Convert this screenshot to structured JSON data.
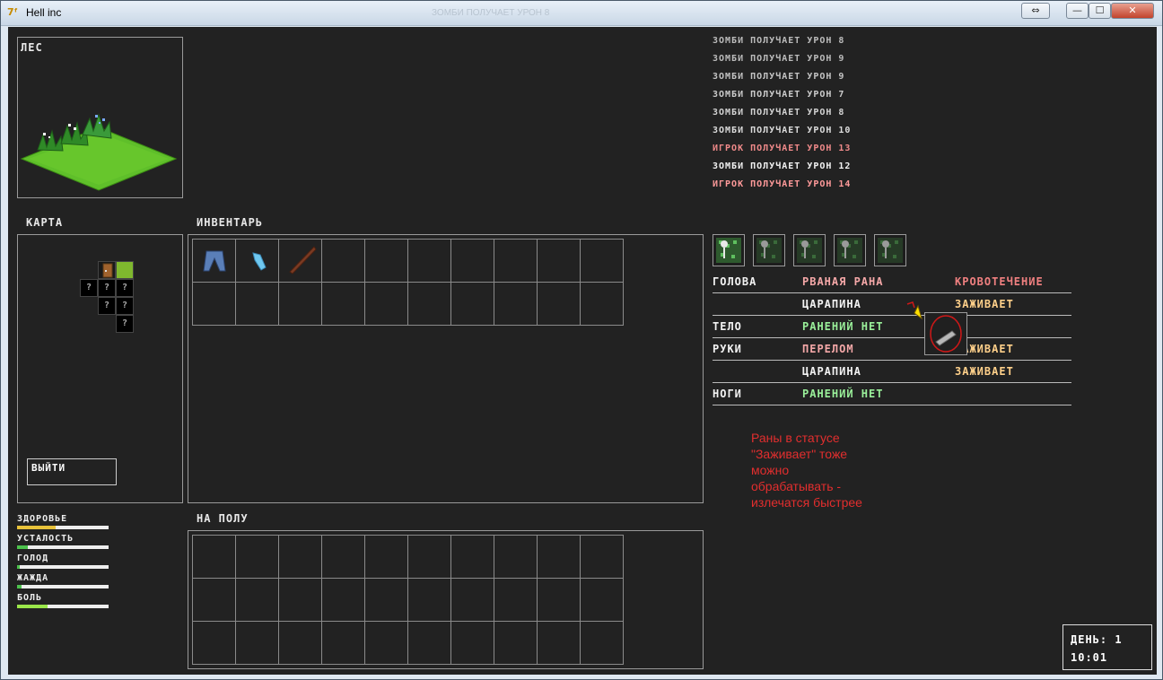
{
  "window": {
    "title": "Hell inc",
    "ghost_title": "ЗОМБИ ПОЛУЧАЕТ УРОН 8",
    "resize_label": "⇔",
    "min_label": "—",
    "max_label": "☐",
    "close_label": "✕"
  },
  "location": {
    "name": "ЛЕС"
  },
  "map": {
    "title": "КАРТА",
    "unknown_mark": "?",
    "exit_label": "ВЫЙТИ"
  },
  "inventory": {
    "title": "ИНВЕНТАРЬ",
    "items": [
      "pants-icon",
      "feather-icon",
      "stick-icon"
    ]
  },
  "floor": {
    "title": "НА ПОЛУ"
  },
  "stats": [
    {
      "name": "ЗДОРОВЬЕ",
      "value": 0.42,
      "color": "#e8c23a"
    },
    {
      "name": "УСТАЛОСТЬ",
      "value": 0.12,
      "color": "#4dc24d"
    },
    {
      "name": "ГОЛОД",
      "value": 0.03,
      "color": "#4dc24d"
    },
    {
      "name": "ЖАЖДА",
      "value": 0.05,
      "color": "#4dc24d"
    },
    {
      "name": "БОЛЬ",
      "value": 0.33,
      "color": "#9ae64a"
    }
  ],
  "log": [
    {
      "text": "ЗОМБИ ПОЛУЧАЕТ УРОН 8",
      "color": "#bcbcbc"
    },
    {
      "text": "ЗОМБИ ПОЛУЧАЕТ УРОН 9",
      "color": "#bcbcbc"
    },
    {
      "text": "ЗОМБИ ПОЛУЧАЕТ УРОН 9",
      "color": "#c4c4c4"
    },
    {
      "text": "ЗОМБИ ПОЛУЧАЕТ УРОН 7",
      "color": "#cccccc"
    },
    {
      "text": "ЗОМБИ ПОЛУЧАЕТ УРОН 8",
      "color": "#d4d4d4"
    },
    {
      "text": "ЗОМБИ ПОЛУЧАЕТ УРОН 10",
      "color": "#dcdcdc"
    },
    {
      "text": "ИГРОК ПОЛУЧАЕТ УРОН 13",
      "color": "#f08a8a"
    },
    {
      "text": "ЗОМБИ ПОЛУЧАЕТ УРОН 12",
      "color": "#f2f2f2"
    },
    {
      "text": "ИГРОК ПОЛУЧАЕТ УРОН 14",
      "color": "#ff9a9a"
    }
  ],
  "tabs": [
    "wounds-tab-icon",
    "heart-tab-icon",
    "grid-tab-icon",
    "plant-tab-icon",
    "sleep-tab-icon"
  ],
  "wounds": [
    {
      "part": "ГОЛОВА",
      "wound": "РВАНАЯ РАНА",
      "status": "КРОВОТЕЧЕНИЕ",
      "wound_color": "#f5a8a8",
      "status_color": "#f08080"
    },
    {
      "part": "",
      "wound": "ЦАРАПИНА",
      "status": "ЗАЖИВАЕТ",
      "wound_color": "#f2f2f2",
      "status_color": "#ffd08a"
    },
    {
      "part": "ТЕЛО",
      "wound": "РАНЕНИЙ НЕТ",
      "status": "",
      "wound_color": "#9af09a",
      "status_color": "#ffd08a"
    },
    {
      "part": "РУКИ",
      "wound": "ПЕРЕЛОМ",
      "status": "ЗАЖИВАЕТ",
      "wound_color": "#f5a8a8",
      "status_color": "#ffd08a"
    },
    {
      "part": "",
      "wound": "ЦАРАПИНА",
      "status": "ЗАЖИВАЕТ",
      "wound_color": "#f2f2f2",
      "status_color": "#ffd08a"
    },
    {
      "part": "НОГИ",
      "wound": "РАНЕНИЙ НЕТ",
      "status": "",
      "wound_color": "#9af09a",
      "status_color": "#ffd08a"
    }
  ],
  "note": "Раны в статусе\n\"Заживает\" тоже\nможно\nобрабатывать -\nизлечатся быстрее",
  "clock": {
    "day": "ДЕНЬ: 1",
    "time": "10:01"
  }
}
